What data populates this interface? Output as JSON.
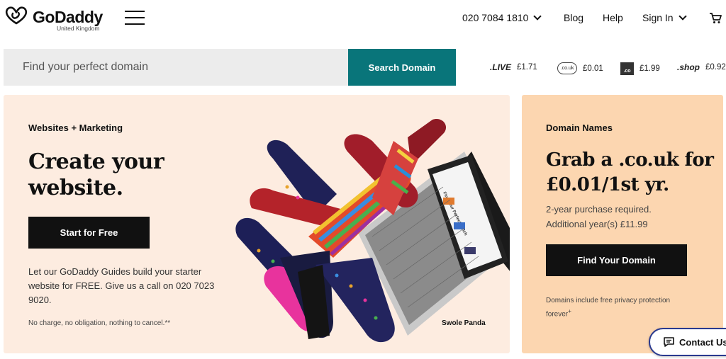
{
  "header": {
    "logo_text": "GoDaddy",
    "logo_region": "United Kingdom",
    "phone": "020 7084 1810",
    "nav": {
      "blog": "Blog",
      "help": "Help",
      "sign_in": "Sign In"
    }
  },
  "search": {
    "placeholder": "Find your perfect domain",
    "button_label": "Search Domain"
  },
  "tlds": [
    {
      "name": ".LIVE",
      "price": "£1.71"
    },
    {
      "name": ".co.uk",
      "price": "£0.01"
    },
    {
      "name": ".co",
      "price": "£1.99"
    },
    {
      "name": ".shop",
      "price": "£0.92"
    }
  ],
  "promo_left": {
    "eyebrow": "Websites + Marketing",
    "headline_line1": "Create your",
    "headline_line2": "website.",
    "cta": "Start for Free",
    "body_line1": "Let our GoDaddy Guides build your starter",
    "body_line2": "website for FREE. Give us a call on 020 7023",
    "body_line3": "9020.",
    "fine_print": "No charge, no obligation, nothing to cancel.**",
    "image_caption": "Swole Panda",
    "laptop_screen_text": "Find Your Perfect Match"
  },
  "promo_right": {
    "eyebrow": "Domain Names",
    "headline_line1": "Grab a .co.uk for",
    "headline_line2": "£0.01/1st yr.",
    "sub_line1": "2-year purchase required.",
    "sub_line2": "Additional year(s) £11.99",
    "cta": "Find Your Domain",
    "fine_line1": "Domains include free privacy protection",
    "fine_line2": "forever",
    "fine_sup": "+"
  },
  "contact": {
    "label": "Contact Us"
  },
  "colors": {
    "teal": "#09757a",
    "peach_light": "#fdece0",
    "peach": "#fcd6b0",
    "dark": "#111111"
  }
}
